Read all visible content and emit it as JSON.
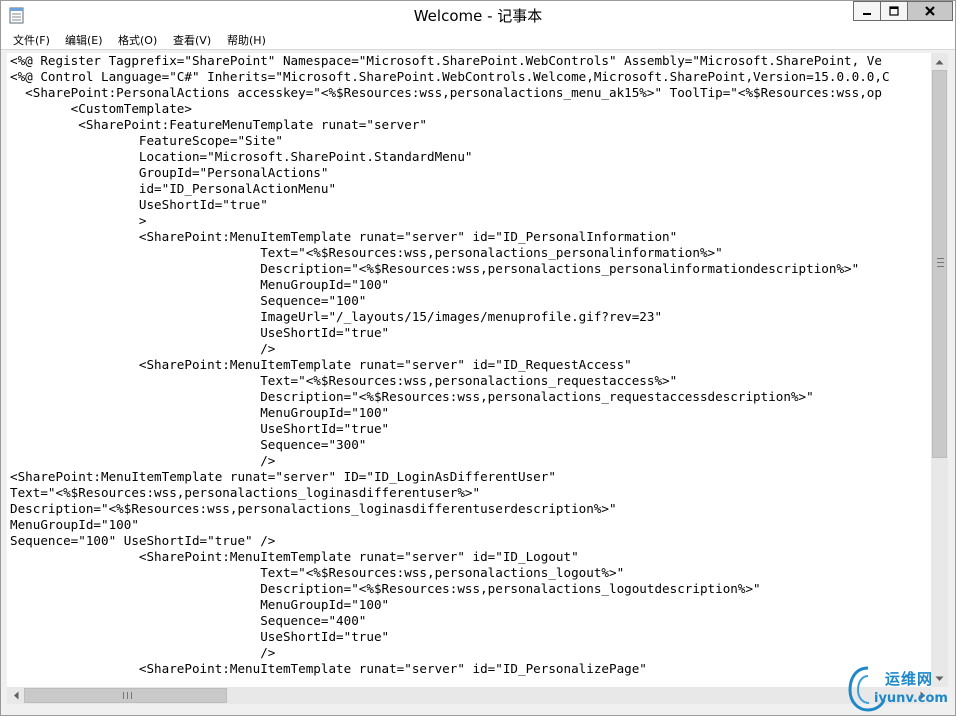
{
  "window": {
    "title": "Welcome - 记事本"
  },
  "menu": {
    "items": [
      "文件(F)",
      "编辑(E)",
      "格式(O)",
      "查看(V)",
      "帮助(H)"
    ]
  },
  "editor": {
    "lines": [
      "<%@ Register Tagprefix=\"SharePoint\" Namespace=\"Microsoft.SharePoint.WebControls\" Assembly=\"Microsoft.SharePoint, Ve",
      "<%@ Control Language=\"C#\" Inherits=\"Microsoft.SharePoint.WebControls.Welcome,Microsoft.SharePoint,Version=15.0.0.0,C",
      "  <SharePoint:PersonalActions accesskey=\"<%$Resources:wss,personalactions_menu_ak15%>\" ToolTip=\"<%$Resources:wss,op",
      "        <CustomTemplate>",
      "         <SharePoint:FeatureMenuTemplate runat=\"server\"",
      "                 FeatureScope=\"Site\"",
      "                 Location=\"Microsoft.SharePoint.StandardMenu\"",
      "                 GroupId=\"PersonalActions\"",
      "                 id=\"ID_PersonalActionMenu\"",
      "                 UseShortId=\"true\"",
      "                 >",
      "                 <SharePoint:MenuItemTemplate runat=\"server\" id=\"ID_PersonalInformation\"",
      "                                 Text=\"<%$Resources:wss,personalactions_personalinformation%>\"",
      "                                 Description=\"<%$Resources:wss,personalactions_personalinformationdescription%>\"",
      "                                 MenuGroupId=\"100\"",
      "                                 Sequence=\"100\"",
      "                                 ImageUrl=\"/_layouts/15/images/menuprofile.gif?rev=23\"",
      "                                 UseShortId=\"true\"",
      "                                 />",
      "                 <SharePoint:MenuItemTemplate runat=\"server\" id=\"ID_RequestAccess\"",
      "                                 Text=\"<%$Resources:wss,personalactions_requestaccess%>\"",
      "                                 Description=\"<%$Resources:wss,personalactions_requestaccessdescription%>\"",
      "                                 MenuGroupId=\"100\"",
      "                                 UseShortId=\"true\"",
      "                                 Sequence=\"300\"",
      "                                 />",
      "<SharePoint:MenuItemTemplate runat=\"server\" ID=\"ID_LoginAsDifferentUser\"",
      "Text=\"<%$Resources:wss,personalactions_loginasdifferentuser%>\"",
      "Description=\"<%$Resources:wss,personalactions_loginasdifferentuserdescription%>\"",
      "MenuGroupId=\"100\"",
      "Sequence=\"100\" UseShortId=\"true\" />",
      "                 <SharePoint:MenuItemTemplate runat=\"server\" id=\"ID_Logout\"",
      "                                 Text=\"<%$Resources:wss,personalactions_logout%>\"",
      "                                 Description=\"<%$Resources:wss,personalactions_logoutdescription%>\"",
      "                                 MenuGroupId=\"100\"",
      "                                 Sequence=\"400\"",
      "                                 UseShortId=\"true\"",
      "                                 />",
      "                 <SharePoint:MenuItemTemplate runat=\"server\" id=\"ID_PersonalizePage\""
    ]
  },
  "watermark": {
    "cn_text": "运维网",
    "en_text": "iyunv.com"
  },
  "icons": {
    "app": "notepad-icon",
    "minimize": "minimize-icon",
    "maximize": "maximize-icon",
    "close": "close-icon"
  },
  "colors": {
    "watermark": "#1e88c8",
    "title_bar": "#ffffff",
    "close_button": "#c7c7c7"
  }
}
